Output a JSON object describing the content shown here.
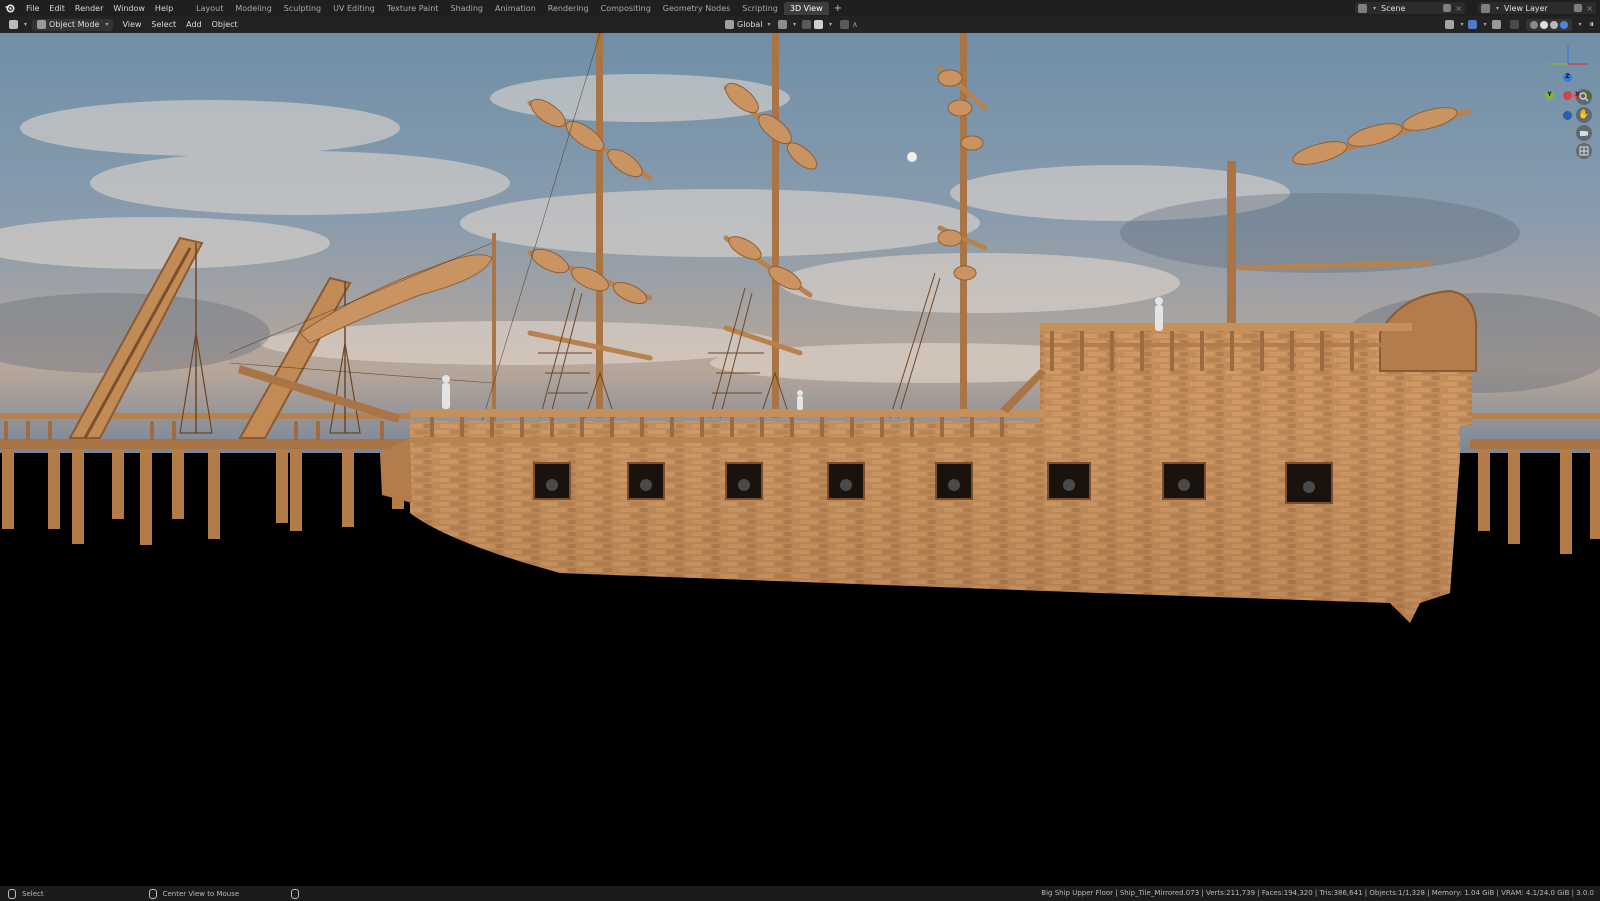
{
  "menubar": {
    "items": [
      "File",
      "Edit",
      "Render",
      "Window",
      "Help"
    ],
    "workspaces": [
      "Layout",
      "Modeling",
      "Sculpting",
      "UV Editing",
      "Texture Paint",
      "Shading",
      "Animation",
      "Rendering",
      "Compositing",
      "Geometry Nodes",
      "Scripting",
      "3D View"
    ],
    "active_workspace": "3D View",
    "add_workspace": "+",
    "scene_name": "Scene",
    "view_layer_name": "View Layer"
  },
  "viewport_header": {
    "mode": "Object Mode",
    "menus": [
      "View",
      "Select",
      "Add",
      "Object"
    ],
    "transform_orientation": "Global"
  },
  "gizmo": {
    "z": "Z",
    "y": "Y",
    "x": "X"
  },
  "statusbar": {
    "left_action": "Select",
    "middle_action": "Center View to Mouse",
    "stats": "Big Ship Upper Floor | Ship_Tile_Mirrored.073 | Verts:211,739 | Faces:194,320 | Tris:386,641 | Objects:1/1,328 | Memory: 1.04 GiB | VRAM: 4.1/24.0 GiB | 3.0.0"
  },
  "colors": {
    "topbar_bg": "#1f1f1f",
    "header_bg": "#232323",
    "active_tab": "#3d3d3d",
    "wood": "#c58a55",
    "wood_dark": "#8a5a32",
    "sky_top": "#6f8fa8",
    "sky_bottom": "#b7a79a",
    "axis_x": "#d4424f",
    "axis_y": "#7fb53c",
    "axis_z": "#3a7bd5"
  }
}
